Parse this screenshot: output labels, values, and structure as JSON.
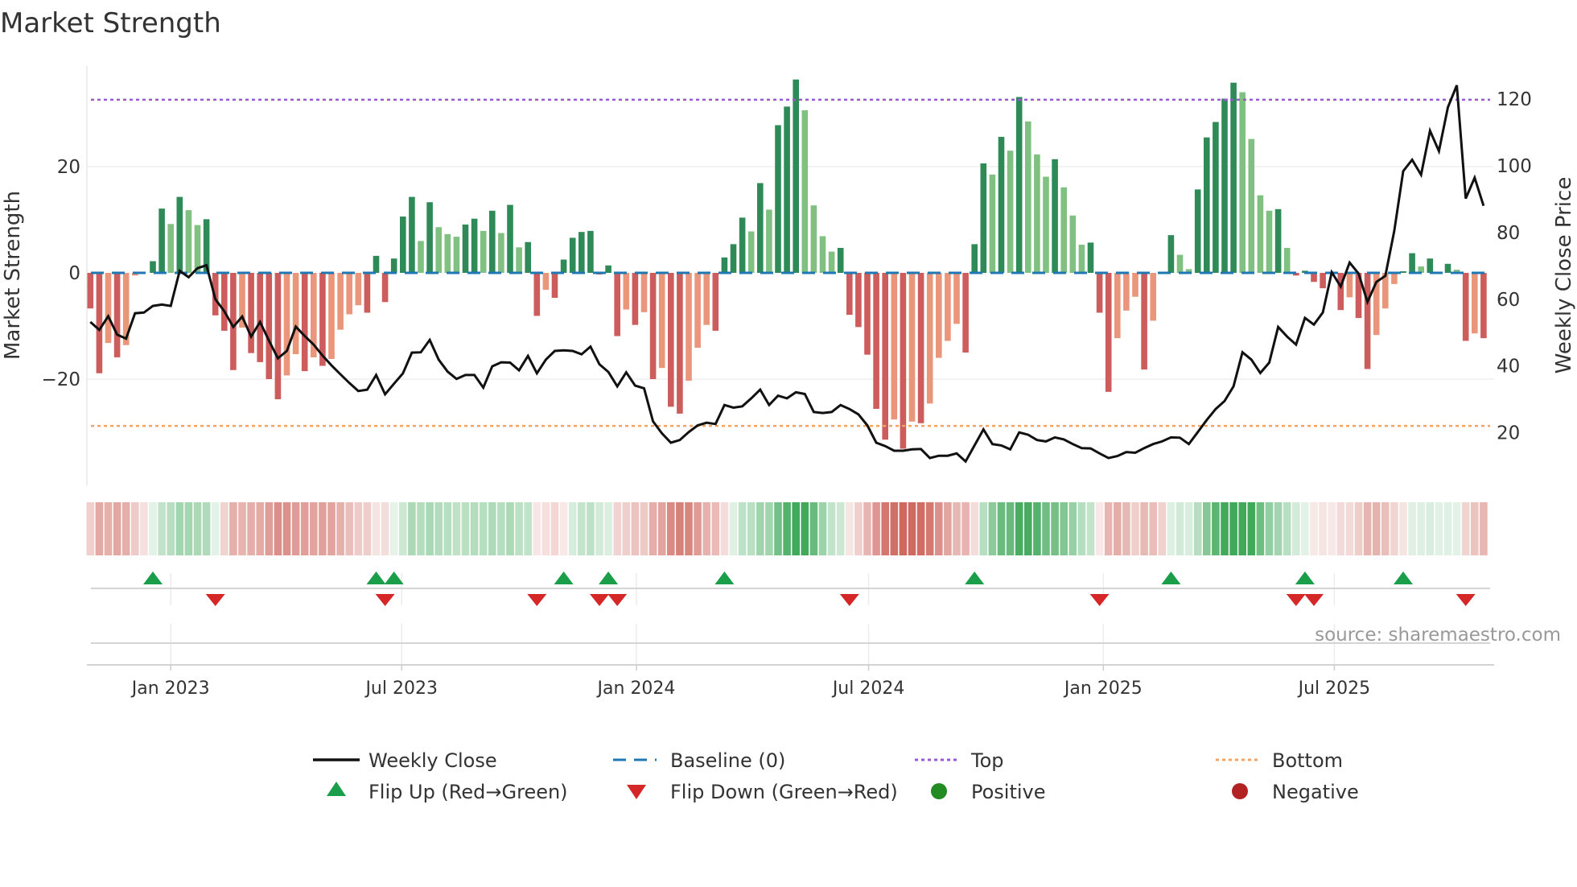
{
  "title": "Market Strength",
  "source": "source: sharemaestro.com",
  "colors": {
    "bar_pos_strong": "#2e8b57",
    "bar_pos_weak": "#80c080",
    "bar_neg_strong": "#cd5c5c",
    "bar_neg_weak": "#e9967a",
    "baseline": "#1f77b4",
    "top": "#9b59d0",
    "bottom": "#f4a460",
    "price": "#111111",
    "flip_up": "#1a9e4a",
    "flip_down": "#d62728",
    "positive": "#228b22",
    "negative": "#b22222"
  },
  "legend": {
    "weekly_close": "Weekly Close",
    "baseline": "Baseline (0)",
    "top": "Top",
    "bottom": "Bottom",
    "flip_up": "Flip Up (Red→Green)",
    "flip_down": "Flip Down (Green→Red)",
    "positive": "Positive",
    "negative": "Negative"
  },
  "chart_data": {
    "type": "bar+line",
    "title": "Market Strength",
    "ylabel": "Market Strength",
    "y2label": "Weekly Close Price",
    "start_week": "2022-10-30",
    "interval_days": 7,
    "ylim": [
      -39,
      39
    ],
    "y2lim": [
      6.3,
      141.5
    ],
    "yticks": [
      {
        "v": 20,
        "label": "20"
      },
      {
        "v": 0,
        "label": "0"
      },
      {
        "v": -20,
        "label": "−20"
      }
    ],
    "y2ticks": [
      {
        "v": 20,
        "label": "20"
      },
      {
        "v": 40,
        "label": "40"
      },
      {
        "v": 60,
        "label": "60"
      },
      {
        "v": 80,
        "label": "80"
      },
      {
        "v": 100,
        "label": "100"
      },
      {
        "v": 120,
        "label": "120"
      }
    ],
    "xticks": [
      {
        "date": "2023-01-01",
        "label": "Jan 2023"
      },
      {
        "date": "2023-07-01",
        "label": "Jul 2023"
      },
      {
        "date": "2024-01-01",
        "label": "Jan 2024"
      },
      {
        "date": "2024-07-01",
        "label": "Jul 2024"
      },
      {
        "date": "2025-01-01",
        "label": "Jan 2025"
      },
      {
        "date": "2025-07-01",
        "label": "Jul 2025"
      }
    ],
    "top_level": 32.6,
    "bottom_level": -28.8,
    "baseline": 0,
    "grid": true,
    "legend_position": "bottom",
    "strength": [
      -6.7,
      -18.9,
      -13.2,
      -15.9,
      -13.6,
      -0.5,
      0,
      2.2,
      12.1,
      9.2,
      14.3,
      11.8,
      9.0,
      10.1,
      -8.0,
      -10.9,
      -18.3,
      -10.3,
      -15.1,
      -16.8,
      -20.0,
      -23.8,
      -19.3,
      -15.3,
      -18.5,
      -15.9,
      -17.5,
      -16.2,
      -10.7,
      -7.8,
      -6.1,
      -7.5,
      3.2,
      -5.5,
      2.7,
      10.6,
      14.3,
      6.0,
      13.3,
      8.6,
      7.3,
      6.8,
      9.1,
      10.2,
      7.9,
      11.7,
      7.5,
      12.8,
      4.8,
      5.8,
      -8.1,
      -3.2,
      -4.7,
      2.5,
      6.6,
      7.7,
      7.9,
      -0.3,
      1.4,
      -11.9,
      -6.9,
      -9.8,
      -7.4,
      -20.0,
      -17.9,
      -25.2,
      -26.5,
      -20.3,
      -14.1,
      -9.8,
      -10.9,
      2.9,
      5.4,
      10.4,
      7.8,
      16.9,
      11.9,
      27.8,
      31.3,
      36.4,
      30.6,
      12.7,
      6.9,
      4.0,
      4.7,
      -7.9,
      -10.2,
      -15.4,
      -25.6,
      -31.4,
      -27.6,
      -33.1,
      -28.0,
      -28.3,
      -24.6,
      -16.0,
      -12.8,
      -9.6,
      -15.0,
      5.4,
      20.6,
      18.5,
      25.6,
      23.0,
      33.1,
      28.5,
      22.3,
      18.1,
      21.4,
      16.1,
      10.8,
      5.3,
      5.7,
      -7.5,
      -22.4,
      -12.3,
      -7.1,
      -4.5,
      -18.2,
      -9.0,
      0,
      7.1,
      3.4,
      0.7,
      15.7,
      25.5,
      28.4,
      32.8,
      35.8,
      34.0,
      25.2,
      14.6,
      11.7,
      12.0,
      4.7,
      -0.5,
      0.4,
      -1.7,
      -2.9,
      0,
      -7.0,
      -4.6,
      -8.5,
      -18.1,
      -11.7,
      -6.7,
      -2.1,
      0.3,
      3.7,
      1.2,
      2.7,
      0.1,
      1.7,
      0.6,
      -12.8,
      -11.4,
      -12.3
    ],
    "weekly_close": [
      53.2,
      50.8,
      54.9,
      49.4,
      48.2,
      55.8,
      56.0,
      58.0,
      58.4,
      58.0,
      68.5,
      66.6,
      69.3,
      70.2,
      60.0,
      56.4,
      51.7,
      54.8,
      48.8,
      53.2,
      47.6,
      42.3,
      44.5,
      51.8,
      49.0,
      46.4,
      43.1,
      40.2,
      37.5,
      34.9,
      32.5,
      32.9,
      37.3,
      31.5,
      34.7,
      37.8,
      44.0,
      44.1,
      47.8,
      41.9,
      38.3,
      36.1,
      37.3,
      37.3,
      33.5,
      39.9,
      41.1,
      41.0,
      38.7,
      43.0,
      37.8,
      41.9,
      44.5,
      44.7,
      44.5,
      43.5,
      45.8,
      40.5,
      38.2,
      33.9,
      38.1,
      34.1,
      33.3,
      23.4,
      19.8,
      17.0,
      17.8,
      20.2,
      22.2,
      23.0,
      22.6,
      28.3,
      27.5,
      27.9,
      30.3,
      32.9,
      28.3,
      31.1,
      30.3,
      32.1,
      31.6,
      26.2,
      25.9,
      26.2,
      28.3,
      27.1,
      25.5,
      22.2,
      17.0,
      16.0,
      14.6,
      14.6,
      15.0,
      15.1,
      12.4,
      13.1,
      13.1,
      13.8,
      11.4,
      16.2,
      21.0,
      16.6,
      16.2,
      15.0,
      20.1,
      19.4,
      17.8,
      17.4,
      18.6,
      18.0,
      16.6,
      15.4,
      15.3,
      13.8,
      12.4,
      13.0,
      14.2,
      14.0,
      15.4,
      16.6,
      17.4,
      18.6,
      18.5,
      16.6,
      20.2,
      23.8,
      27.1,
      29.5,
      33.9,
      44.1,
      41.9,
      37.9,
      41.0,
      51.7,
      48.8,
      46.4,
      54.4,
      52.4,
      56.0,
      68.1,
      63.8,
      71.0,
      67.7,
      59.2,
      65.2,
      67.0,
      80.5,
      98.4,
      101.8,
      97.3,
      110.5,
      104.4,
      117.5,
      124.1,
      90.2,
      96.4,
      88.0
    ],
    "flip_up_weeks": [
      7,
      32,
      34,
      53,
      58,
      71,
      99,
      121,
      136,
      147
    ],
    "flip_down_weeks": [
      14,
      33,
      50,
      57,
      59,
      85,
      113,
      135,
      137,
      154
    ]
  }
}
